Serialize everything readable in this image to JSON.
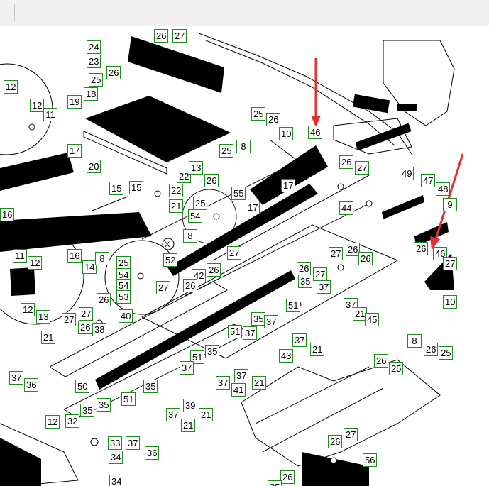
{
  "callouts": [
    "26",
    "27",
    "24",
    "23",
    "25",
    "26",
    "12",
    "18",
    "19",
    "12",
    "11",
    "25",
    "26",
    "10",
    "46",
    "25",
    "8",
    "17",
    "20",
    "22",
    "13",
    "26",
    "22",
    "26",
    "27",
    "49",
    "47",
    "48",
    "55",
    "17",
    "15",
    "15",
    "21",
    "25",
    "54",
    "17",
    "44",
    "9",
    "16",
    "8",
    "26",
    "46",
    "27",
    "11",
    "12",
    "16",
    "14",
    "8",
    "25",
    "54",
    "54",
    "52",
    "27",
    "27",
    "26",
    "26",
    "42",
    "26",
    "26",
    "27",
    "35",
    "37",
    "26",
    "53",
    "27",
    "12",
    "26",
    "27",
    "40",
    "38",
    "35",
    "37",
    "51",
    "37",
    "21",
    "45",
    "10",
    "13",
    "26",
    "21",
    "27",
    "51",
    "37",
    "43",
    "37",
    "21",
    "8",
    "26",
    "25",
    "37",
    "36",
    "51",
    "35",
    "26",
    "25",
    "37",
    "50",
    "35",
    "37",
    "41",
    "21",
    "37",
    "51",
    "35",
    "35",
    "39",
    "21",
    "12",
    "32",
    "37",
    "21",
    "33",
    "37",
    "36",
    "34",
    "26",
    "27",
    "56",
    "34",
    "26",
    "25"
  ],
  "arrow_color": "#e03030",
  "callout_border": "#1a8f1a"
}
